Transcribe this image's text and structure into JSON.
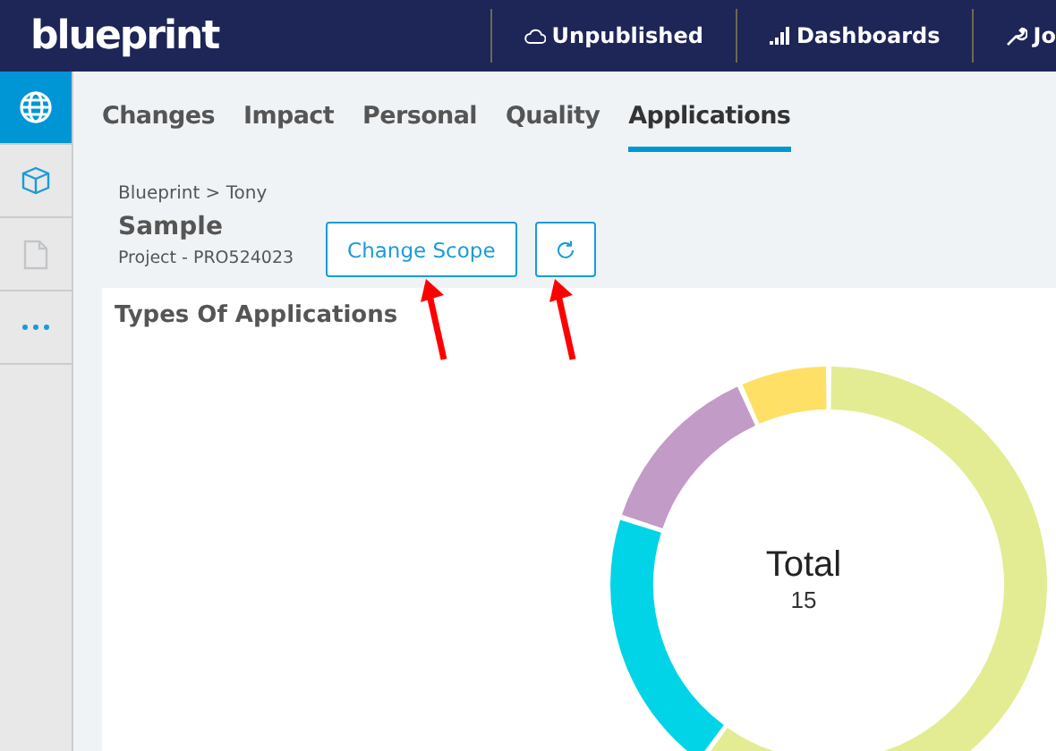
{
  "topbar": {
    "logo": "blueprint",
    "items": [
      {
        "label": "Unpublished",
        "kind": "cloud"
      },
      {
        "label": "Dashboards",
        "kind": "bars"
      },
      {
        "label": "Jo",
        "kind": "wrench"
      }
    ]
  },
  "sidebar": {
    "items": [
      {
        "kind": "globe",
        "selected": true
      },
      {
        "kind": "cube",
        "selected": false
      },
      {
        "kind": "page",
        "selected": false
      },
      {
        "kind": "dots",
        "selected": false
      }
    ]
  },
  "tabs": [
    {
      "label": "Changes",
      "selected": false
    },
    {
      "label": "Impact",
      "selected": false
    },
    {
      "label": "Personal",
      "selected": false
    },
    {
      "label": "Quality",
      "selected": false
    },
    {
      "label": "Applications",
      "selected": true
    }
  ],
  "header": {
    "breadcrumb": "Blueprint > Tony",
    "title": "Sample",
    "subtitle": "Project - PRO524023",
    "change_scope_button": "Change Scope"
  },
  "card": {
    "title": "Types Of Applications",
    "donut": {
      "center_label": "Total",
      "center_value": "15",
      "segments": [
        {
          "color": "#e3ec93"
        },
        {
          "color": "#00d4e6"
        },
        {
          "color": "#c29bc6"
        },
        {
          "color": "#ffe066"
        }
      ]
    }
  }
}
